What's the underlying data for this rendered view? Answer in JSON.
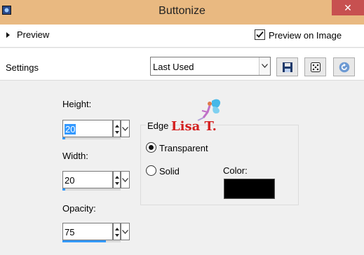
{
  "window": {
    "title": "Buttonize",
    "close_glyph": "✕"
  },
  "preview": {
    "label": "Preview",
    "preview_on_image_label": "Preview on Image",
    "preview_on_image_checked": true
  },
  "settings": {
    "label": "Settings",
    "preset_value": "Last Used",
    "buttons": [
      "save-icon",
      "randomize-dice-icon",
      "reset-icon"
    ]
  },
  "fields": {
    "height": {
      "label": "Height:",
      "value": "20",
      "selected": true,
      "fill_fraction": 0.05
    },
    "width": {
      "label": "Width:",
      "value": "20",
      "fill_fraction": 0.05
    },
    "opacity": {
      "label": "Opacity:",
      "value": "75",
      "fill_fraction": 0.75
    }
  },
  "edge": {
    "label": "Edge",
    "options": [
      {
        "label": "Transparent",
        "selected": true
      },
      {
        "label": "Solid",
        "selected": false
      }
    ],
    "color_label": "Color:",
    "color_value": "#000000"
  },
  "watermark": {
    "text": "Lisa T."
  },
  "colors": {
    "titlebar": "#e9b981",
    "close": "#c75050",
    "accent": "#3399ff"
  }
}
